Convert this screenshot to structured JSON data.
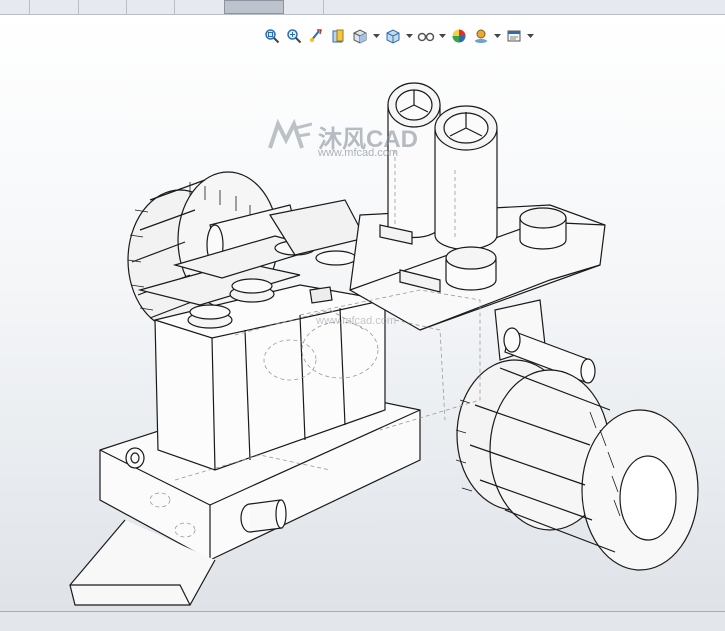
{
  "window": {
    "tabs": [
      {
        "id": "tab-1"
      },
      {
        "id": "tab-2"
      },
      {
        "id": "tab-3"
      },
      {
        "id": "tab-4"
      },
      {
        "id": "tab-5",
        "active": true
      },
      {
        "id": "tab-6"
      }
    ]
  },
  "heads_up_toolbar": {
    "buttons": [
      {
        "icon": "zoom-to-fit-icon"
      },
      {
        "icon": "zoom-to-area-icon"
      },
      {
        "icon": "previous-view-icon"
      },
      {
        "icon": "section-view-icon"
      },
      {
        "icon": "view-orientation-icon",
        "dropdown": true
      },
      {
        "icon": "display-style-icon",
        "dropdown": true
      },
      {
        "icon": "hide-show-items-icon",
        "dropdown": true
      },
      {
        "icon": "edit-appearance-icon"
      },
      {
        "icon": "apply-scene-icon",
        "dropdown": true
      },
      {
        "icon": "view-settings-icon",
        "dropdown": true
      }
    ]
  },
  "watermark": {
    "logo_text": "MF",
    "brand": "沐风CAD",
    "url": "www.mfcad.com",
    "url_center": "www.mfcad.com"
  },
  "colors": {
    "viewport_top": "#ffffff",
    "viewport_bottom": "#dfe3e8",
    "edge": "#1a1a1a",
    "hidden_edge": "#9a9a9a",
    "face": "#f7f7f7",
    "toolbar_accent": "#2a6db5"
  }
}
